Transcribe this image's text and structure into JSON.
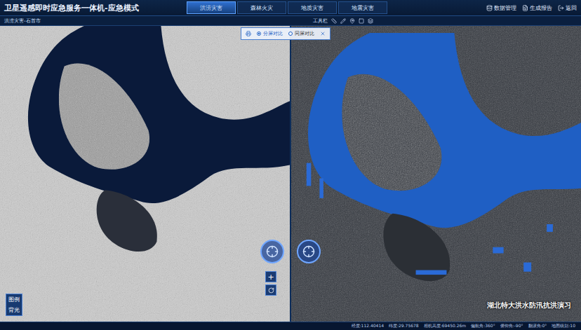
{
  "window": {
    "title": "卫星遥感即时应急服务一体机-应急模式"
  },
  "tabs": [
    {
      "label": "洪涝灾害",
      "selected": true
    },
    {
      "label": "森林火灾",
      "selected": false
    },
    {
      "label": "地质灾害",
      "selected": false
    },
    {
      "label": "地震灾害",
      "selected": false
    }
  ],
  "header_actions": [
    {
      "label": "数据管理",
      "icon": "database"
    },
    {
      "label": "生成报告",
      "icon": "report"
    },
    {
      "label": "返回",
      "icon": "back"
    }
  ],
  "location": "洪涝灾害-石首市",
  "toolbar": {
    "label": "工具栏"
  },
  "compare": [
    {
      "label": "分屏对比",
      "selected": true
    },
    {
      "label": "同屏对比",
      "selected": false
    }
  ],
  "map_controls": {
    "zoom_in": "+"
  },
  "side_buttons": [
    {
      "label": "图例"
    },
    {
      "label": "背光"
    }
  ],
  "caption": "湖北特大洪水防汛抗洪演习",
  "status_bar": [
    "经度:112.40414",
    "纬度:29.75678",
    "相机高度:69450.26m",
    "偏航角:360°",
    "俯仰角:-90°",
    "翻滚角:0°",
    "地图级别:10"
  ]
}
